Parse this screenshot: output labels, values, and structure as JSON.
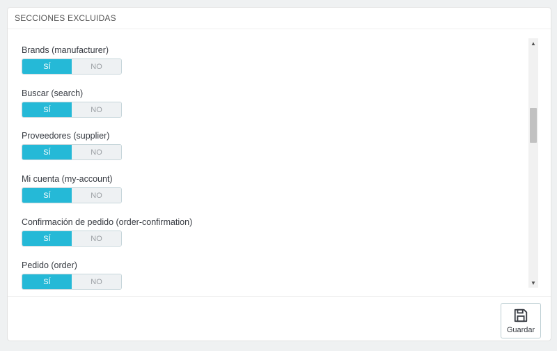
{
  "panel": {
    "title": "SECCIONES EXCLUIDAS"
  },
  "fields": [
    {
      "label": "Brands (manufacturer)",
      "on_label": "SÍ",
      "off_label": "NO",
      "value": "SÍ"
    },
    {
      "label": "Buscar (search)",
      "on_label": "SÍ",
      "off_label": "NO",
      "value": "SÍ"
    },
    {
      "label": "Proveedores (supplier)",
      "on_label": "SÍ",
      "off_label": "NO",
      "value": "SÍ"
    },
    {
      "label": "Mi cuenta (my-account)",
      "on_label": "SÍ",
      "off_label": "NO",
      "value": "SÍ"
    },
    {
      "label": "Confirmación de pedido (order-confirmation)",
      "on_label": "SÍ",
      "off_label": "NO",
      "value": "SÍ"
    },
    {
      "label": "Pedido (order)",
      "on_label": "SÍ",
      "off_label": "NO",
      "value": "SÍ"
    }
  ],
  "footer": {
    "save_label": "Guardar",
    "save_icon": "floppy-disk-icon"
  },
  "colors": {
    "switch_on": "#25b9d7",
    "switch_off": "#eef1f3"
  }
}
